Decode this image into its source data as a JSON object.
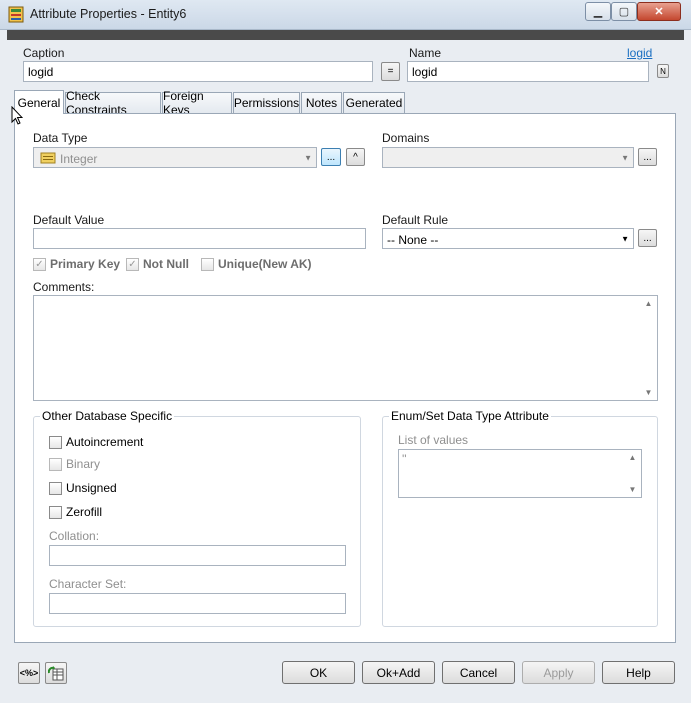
{
  "window": {
    "title": "Attribute Properties - Entity6"
  },
  "header": {
    "caption_label": "Caption",
    "caption_value": "logid",
    "equals_button": "=",
    "name_label": "Name",
    "name_link": "logid",
    "name_value": "logid"
  },
  "tabs": [
    {
      "label": "General"
    },
    {
      "label": "Check Constraints"
    },
    {
      "label": "Foreign Keys"
    },
    {
      "label": "Permissions"
    },
    {
      "label": "Notes"
    },
    {
      "label": "Generated"
    }
  ],
  "general": {
    "data_type_label": "Data Type",
    "data_type_value": "Integer",
    "browse_button": "...",
    "up_button": "^",
    "domains_label": "Domains",
    "domains_value": "",
    "default_value_label": "Default Value",
    "default_value": "",
    "default_rule_label": "Default Rule",
    "default_rule_value": "-- None --",
    "primary_key_label": "Primary Key",
    "not_null_label": "Not Null",
    "unique_label": "Unique(New AK)",
    "comments_label": "Comments:"
  },
  "other_db": {
    "title": "Other Database Specific",
    "autoincrement": "Autoincrement",
    "binary": "Binary",
    "unsigned": "Unsigned",
    "zerofill": "Zerofill",
    "collation_label": "Collation:",
    "charset_label": "Character Set:"
  },
  "enum_set": {
    "title": "Enum/Set Data Type Attribute",
    "list_label": "List of values",
    "list_value": "''"
  },
  "footer": {
    "ok": "OK",
    "ok_add": "Ok+Add",
    "cancel": "Cancel",
    "apply": "Apply",
    "help": "Help",
    "tool1": "<%>"
  }
}
